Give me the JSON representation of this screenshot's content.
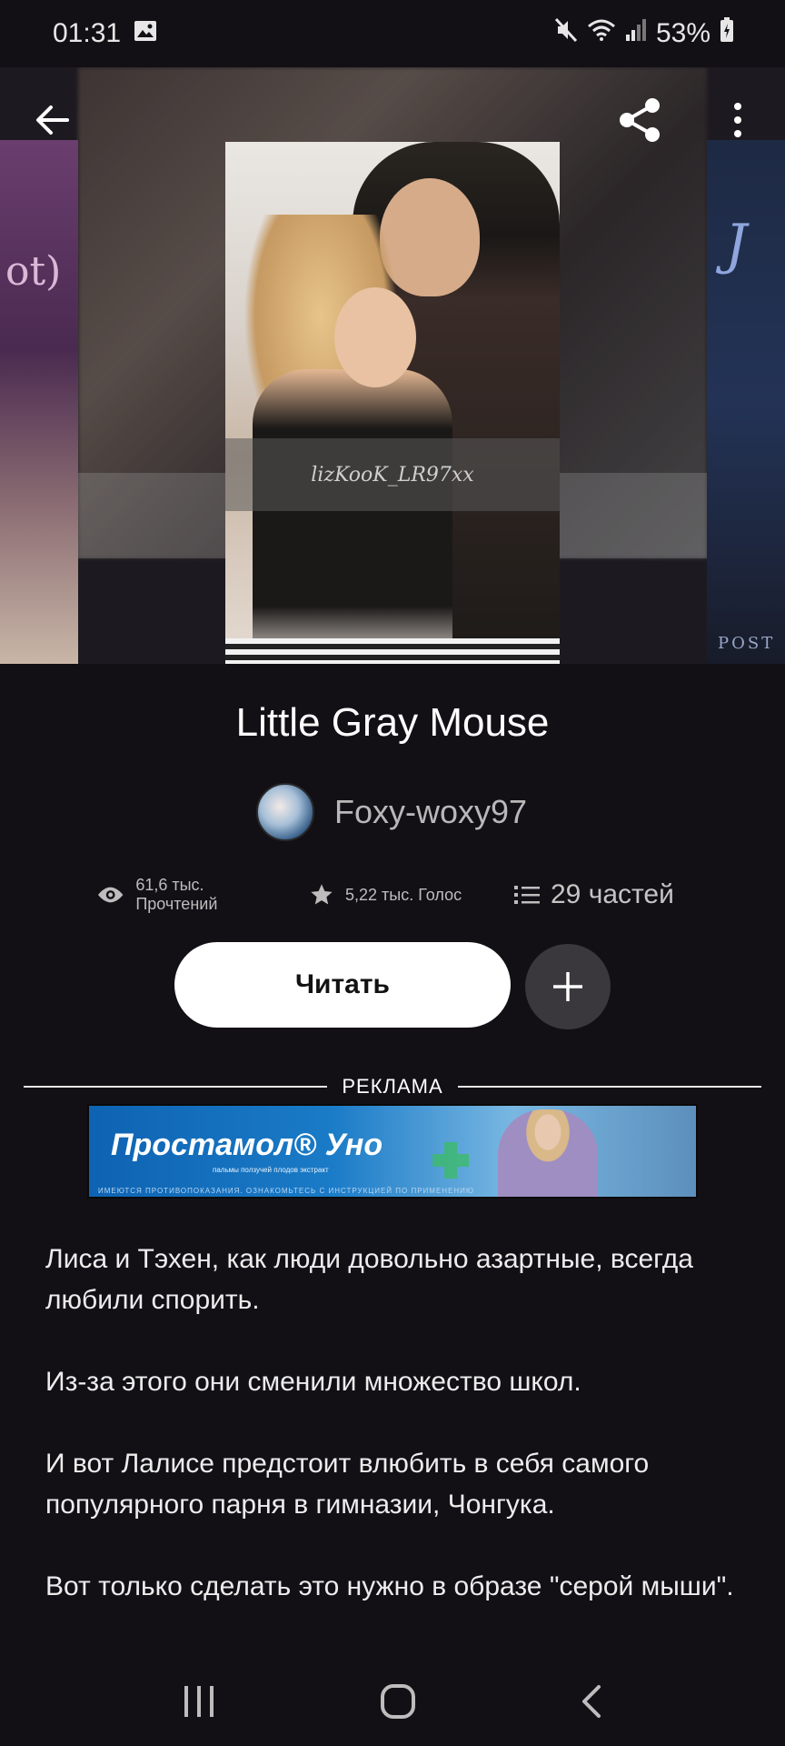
{
  "status_bar": {
    "time": "01:31",
    "battery": "53%",
    "icons": [
      "gallery-icon",
      "mute-icon",
      "wifi-icon",
      "signal-icon",
      "battery-icon"
    ]
  },
  "topbar": {
    "back_icon": "back-arrow-icon",
    "share_icon": "share-icon",
    "menu_icon": "more-vertical-icon"
  },
  "cover": {
    "watermark": "lizKooK_LR97xx",
    "right_side_text": "J",
    "right_side_bottom": "POST",
    "left_side_text": "ot)"
  },
  "story": {
    "title": "Little Gray Mouse",
    "author": "Foxy-woxy97",
    "stats": {
      "reads": "61,6 тыс. Прочтений",
      "votes": "5,22 тыс. Голос",
      "parts": "29 частей"
    }
  },
  "actions": {
    "read_label": "Читать",
    "add_icon": "plus-icon"
  },
  "ad": {
    "label": "РЕКЛАМА",
    "brand": "Простамол® Уно",
    "sub": "пальмы ползучей плодов экстракт",
    "disclaimer": "ИМЕЮТСЯ ПРОТИВОПОКАЗАНИЯ. ОЗНАКОМЬТЕСЬ С ИНСТРУКЦИЕЙ ПО ПРИМЕНЕНИЮ"
  },
  "description": [
    "Лиса и Тэхен, как люди довольно азартные, всегда любили спорить.",
    "Из-за этого они сменили множество школ.",
    "И вот Лалисе предстоит влюбить в себя самого популярного парня в гимназии, Чонгука.",
    "Вот только сделать это нужно в образе \"серой мыши\"."
  ],
  "nav": {
    "recents_icon": "recents-icon",
    "home_icon": "home-icon",
    "back_icon": "nav-back-icon"
  },
  "colors": {
    "background": "#121015",
    "button_bg": "#ffffff",
    "add_button_bg": "#3a383d",
    "text_secondary": "#bdbdbd"
  }
}
